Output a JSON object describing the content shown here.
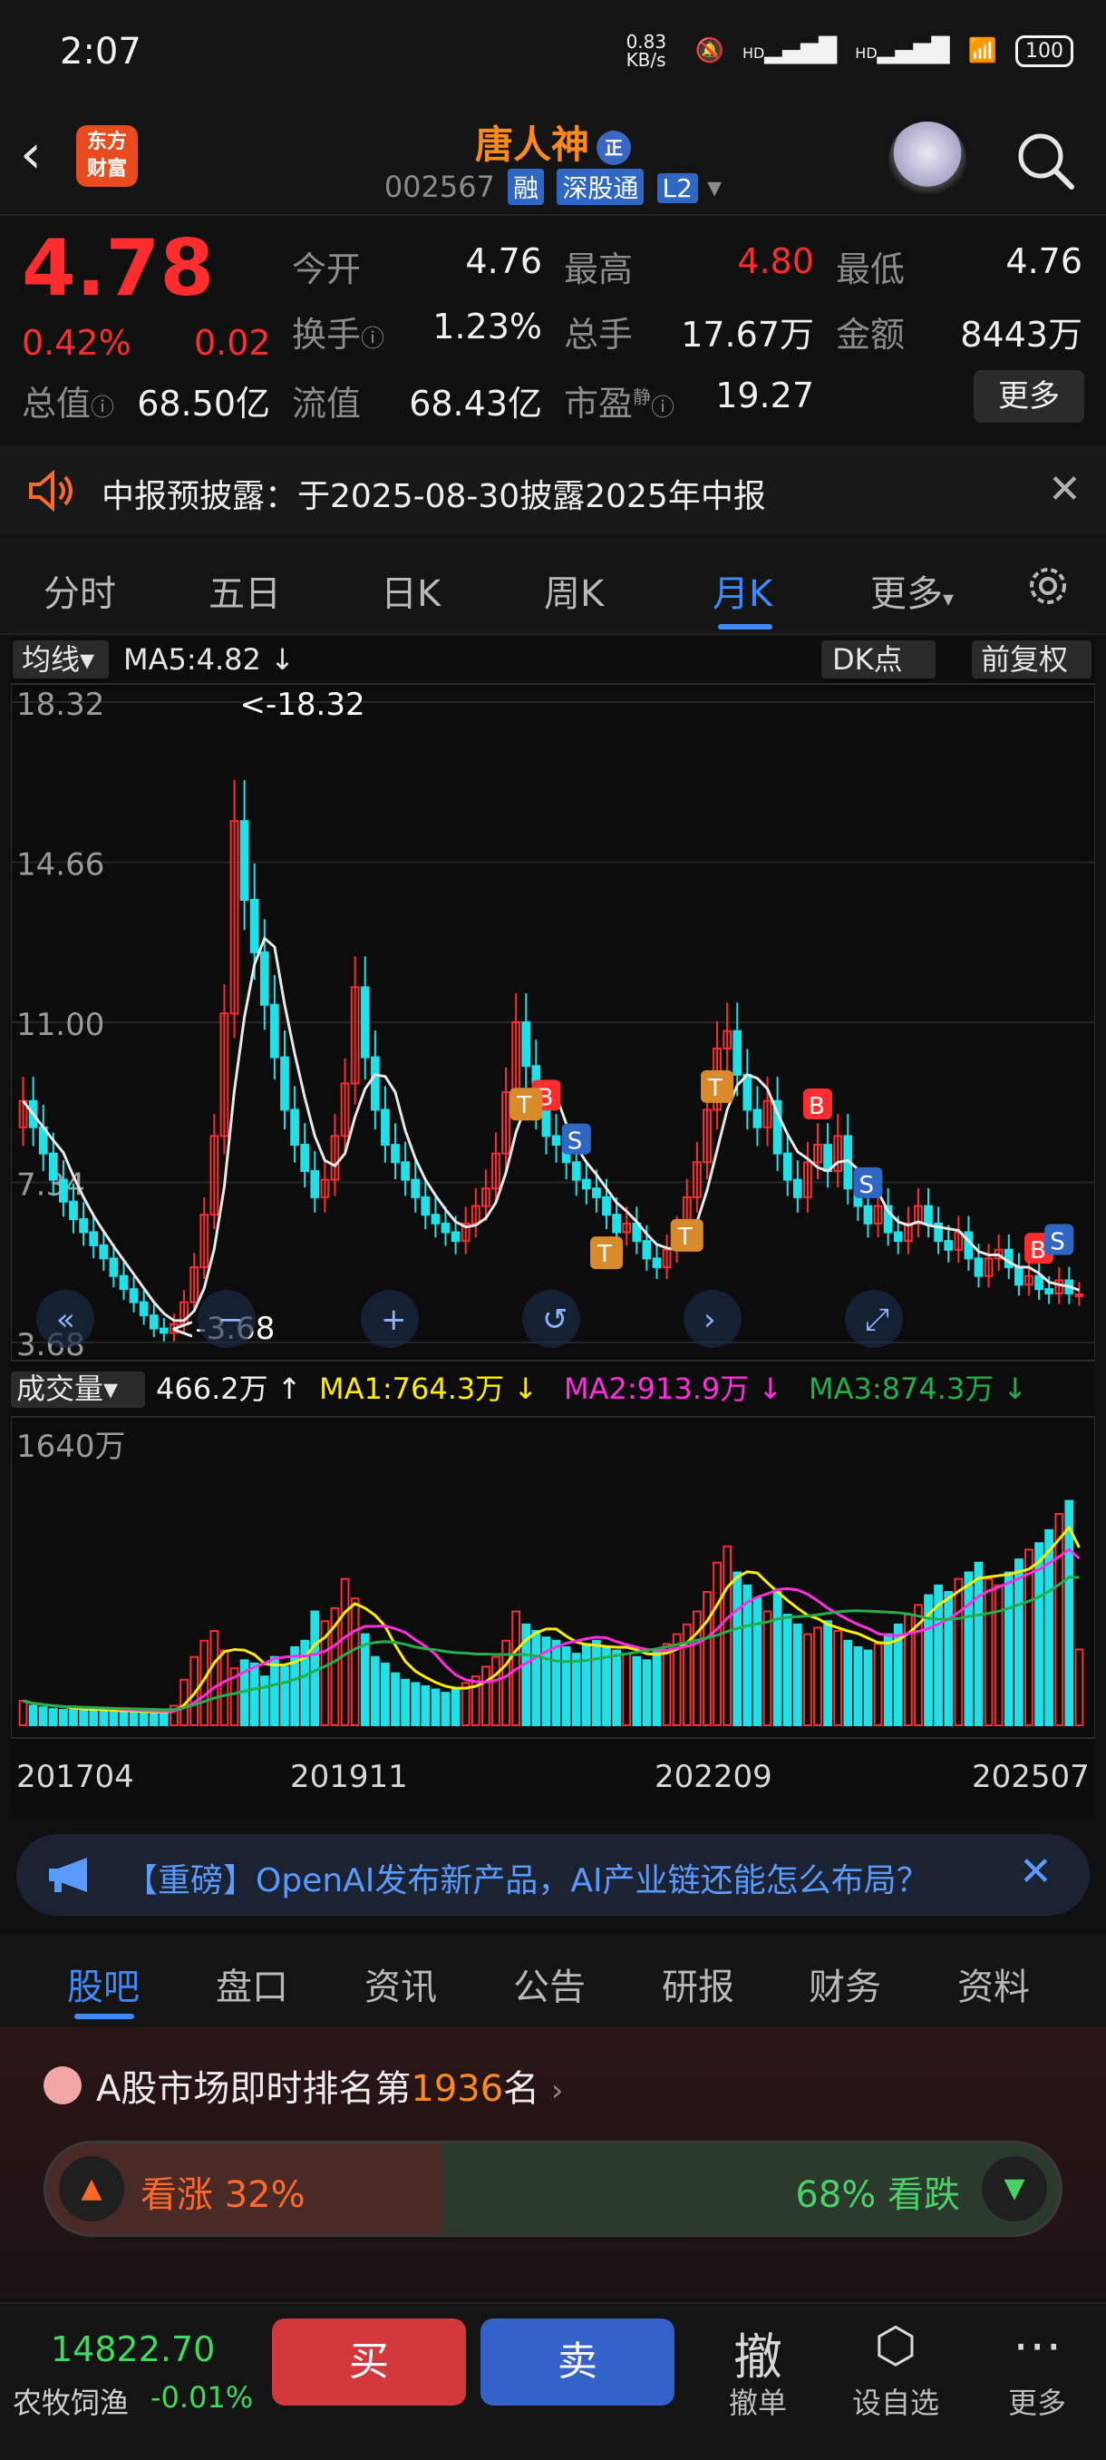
{
  "status_bar": {
    "time": "2:07",
    "net_speed": "0.83 KB/s",
    "signal1": "HD",
    "signal2": "HD",
    "battery": "100"
  },
  "header": {
    "logo_text": "东方\n财富",
    "stock_name": "唐人神",
    "name_badge": "正",
    "stock_code": "002567",
    "tags": [
      "融",
      "深股通",
      "L2"
    ]
  },
  "quote": {
    "price": "4.78",
    "change_pct": "0.42%",
    "change_abs": "0.02",
    "rows": [
      [
        {
          "label": "今开",
          "value": "4.76"
        },
        {
          "label": "最高",
          "value": "4.80",
          "red": true
        },
        {
          "label": "最低",
          "value": "4.76"
        }
      ],
      [
        {
          "label": "换手",
          "value": "1.23%"
        },
        {
          "label": "总手",
          "value": "17.67万"
        },
        {
          "label": "金额",
          "value": "8443万"
        }
      ]
    ],
    "total_value_label": "总值",
    "total_value": "68.50亿",
    "float_label": "流值",
    "float_value": "68.43亿",
    "pe_label": "市盈",
    "pe_sup": "静",
    "pe_value": "19.27",
    "more": "更多"
  },
  "notice": {
    "text": "中报预披露：于2025-08-30披露2025年中报"
  },
  "k_tabs": {
    "items": [
      "分时",
      "五日",
      "日K",
      "周K",
      "月K",
      "更多"
    ],
    "active": "月K"
  },
  "chart_data": {
    "type": "candlestick",
    "period": "monthly",
    "indicator_label": "均线",
    "ma5_label": "MA5:4.82",
    "dk_label": "DK点",
    "adjust_label": "前复权",
    "y_ticks": [
      "18.32",
      "14.66",
      "11.00",
      "7.34",
      "3.68"
    ],
    "y_range": [
      3.68,
      18.32
    ],
    "max_label": "<-18.32",
    "min_label": "<-3.68",
    "x_ticks": [
      "201704",
      "201911",
      "202209",
      "202507"
    ],
    "volume_label": "成交量",
    "volume_value": "466.2万",
    "vol_ma1": "MA1:764.3万",
    "vol_ma2": "MA2:913.9万",
    "vol_ma3": "MA3:874.3万",
    "vol_max_label": "1640万",
    "closes": [
      9.2,
      8.6,
      8.0,
      7.4,
      6.9,
      6.5,
      6.2,
      5.9,
      5.6,
      5.2,
      4.9,
      4.6,
      4.3,
      4.0,
      3.9,
      4.1,
      4.6,
      5.4,
      6.6,
      8.4,
      11.2,
      15.6,
      13.8,
      12.6,
      11.4,
      10.2,
      9.0,
      8.2,
      7.6,
      7.0,
      7.4,
      8.4,
      9.6,
      11.8,
      10.2,
      9.0,
      8.2,
      7.8,
      7.4,
      7.0,
      6.6,
      6.4,
      6.2,
      6.0,
      6.4,
      6.8,
      7.2,
      8.0,
      9.4,
      11.0,
      10.0,
      9.0,
      8.4,
      8.2,
      7.8,
      7.4,
      7.2,
      7.0,
      6.6,
      6.2,
      6.4,
      6.0,
      5.6,
      5.4,
      5.8,
      6.2,
      7.0,
      7.8,
      9.0,
      10.4,
      10.8,
      9.8,
      9.0,
      8.6,
      9.2,
      8.0,
      7.4,
      7.0,
      7.8,
      8.2,
      7.6,
      8.4,
      7.2,
      6.8,
      6.4,
      6.8,
      6.2,
      6.0,
      6.4,
      6.8,
      6.4,
      6.0,
      5.8,
      6.2,
      5.6,
      5.2,
      5.6,
      5.8,
      5.4,
      5.0,
      5.2,
      4.9,
      4.8,
      5.1,
      4.8,
      4.78
    ],
    "opens": [
      8.6,
      9.2,
      8.6,
      8.0,
      7.4,
      6.9,
      6.5,
      6.2,
      5.9,
      5.6,
      5.2,
      4.9,
      4.6,
      4.3,
      4.0,
      3.9,
      4.1,
      4.6,
      5.4,
      6.6,
      8.4,
      11.2,
      15.6,
      13.8,
      12.6,
      11.4,
      10.2,
      9.0,
      8.2,
      7.6,
      7.0,
      7.4,
      8.4,
      9.6,
      11.8,
      10.2,
      9.0,
      8.2,
      7.8,
      7.4,
      7.0,
      6.6,
      6.4,
      6.2,
      6.0,
      6.4,
      6.8,
      7.2,
      8.0,
      9.4,
      11.0,
      10.0,
      9.0,
      8.4,
      8.2,
      7.8,
      7.4,
      7.2,
      7.0,
      6.6,
      6.2,
      6.4,
      6.0,
      5.6,
      5.4,
      5.8,
      6.2,
      7.0,
      7.8,
      9.0,
      10.4,
      10.8,
      9.8,
      9.0,
      8.6,
      9.2,
      8.0,
      7.4,
      7.0,
      7.8,
      8.2,
      7.6,
      8.4,
      7.2,
      6.8,
      6.4,
      6.8,
      6.2,
      6.0,
      6.4,
      6.8,
      6.4,
      6.0,
      5.8,
      6.2,
      5.6,
      5.2,
      5.6,
      5.8,
      5.4,
      5.0,
      5.2,
      4.9,
      4.8,
      5.1,
      4.76
    ],
    "volumes": [
      150,
      120,
      110,
      100,
      95,
      105,
      90,
      100,
      85,
      80,
      90,
      85,
      80,
      75,
      70,
      120,
      280,
      420,
      520,
      580,
      460,
      350,
      400,
      380,
      300,
      420,
      360,
      480,
      520,
      700,
      640,
      720,
      900,
      780,
      560,
      420,
      380,
      320,
      280,
      260,
      240,
      220,
      200,
      220,
      260,
      300,
      360,
      420,
      520,
      700,
      620,
      580,
      540,
      520,
      480,
      440,
      500,
      520,
      480,
      460,
      440,
      420,
      400,
      460,
      500,
      560,
      620,
      700,
      820,
      1000,
      1100,
      940,
      860,
      780,
      700,
      820,
      680,
      620,
      560,
      600,
      640,
      580,
      520,
      480,
      460,
      500,
      560,
      620,
      680,
      740,
      800,
      860,
      820,
      900,
      940,
      1000,
      900,
      860,
      940,
      1020,
      1080,
      1120,
      1200,
      1300,
      1380,
      466
    ]
  },
  "chart_signals": {
    "buy": "B",
    "sell": "S",
    "t": "T"
  },
  "promo": {
    "text": "【重磅】OpenAI发布新产品，AI产业链还能怎么布局？"
  },
  "bottom_tabs": {
    "items": [
      "股吧",
      "盘口",
      "资讯",
      "公告",
      "研报",
      "财务",
      "资料"
    ],
    "active": "股吧"
  },
  "ranking": {
    "prefix": "A股市场即时排名第",
    "rank": "1936",
    "suffix": "名",
    "up_label": "看涨 32%",
    "down_label": "68% 看跌",
    "up_pct": 32
  },
  "toolbar": {
    "index_value": "14822.70",
    "index_name": "农牧饲渔",
    "index_change": "-0.01%",
    "buy": "买",
    "sell": "卖",
    "items": [
      {
        "glyph": "撤",
        "label": "撤单"
      },
      {
        "glyph": "⬡",
        "label": "设自选"
      },
      {
        "glyph": "⋯",
        "label": "更多"
      }
    ]
  },
  "colors": {
    "up": "#ff2d2d",
    "down": "#22e0e8",
    "accent": "#3d8bff",
    "ma5": "#e8e8e8",
    "ma1": "#ffee00",
    "ma2": "#ff2fe0",
    "ma3": "#22b04a"
  }
}
